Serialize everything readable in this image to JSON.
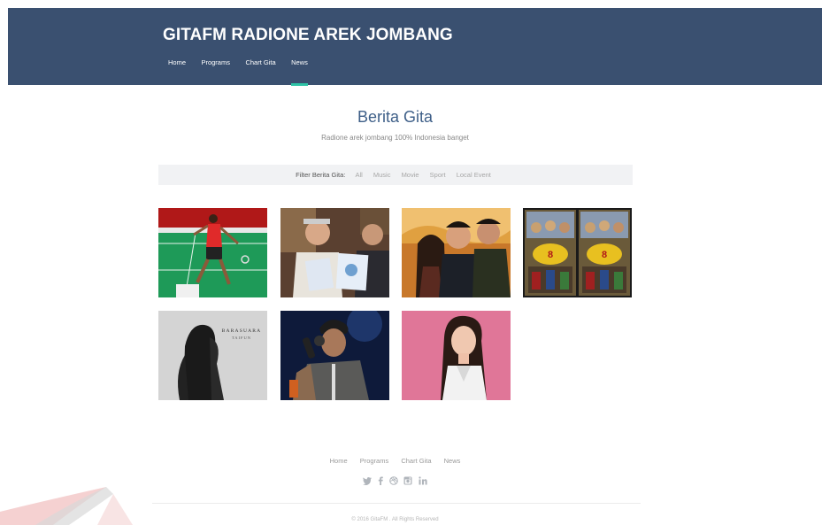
{
  "header": {
    "title": "GITAFM RADIONE AREK JOMBANG",
    "nav": [
      "Home",
      "Programs",
      "Chart Gita",
      "News"
    ],
    "active_nav": "News",
    "background": "#3a5070",
    "accent": "#2ec4a6"
  },
  "section": {
    "title": "Berita Gita",
    "subtitle": "Radione arek jombang 100% Indonesia banget"
  },
  "filter": {
    "label": "Filter Berita Gita:",
    "options": [
      "All",
      "Music",
      "Movie",
      "Sport",
      "Local Event"
    ]
  },
  "news_items": [
    {
      "image": "badminton-player-photo"
    },
    {
      "image": "officials-holding-certificate-photo"
    },
    {
      "image": "movie-poster-three-actors"
    },
    {
      "image": "movie-poster-comic-8-kasino-king"
    },
    {
      "image": "barasuara-taifun-album-cover",
      "cover_text": "BARASUARA",
      "cover_subtext": "TAIFUN"
    },
    {
      "image": "singer-with-microphone-photo"
    },
    {
      "image": "woman-portrait-pink-background"
    }
  ],
  "footer": {
    "nav": [
      "Home",
      "Programs",
      "Chart Gita",
      "News"
    ],
    "social_icons": [
      "twitter-icon",
      "facebook-icon",
      "dribbble-icon",
      "instagram-icon",
      "linkedin-icon"
    ],
    "copyright": "© 2016 GitaFM . All Rights Reserved"
  }
}
